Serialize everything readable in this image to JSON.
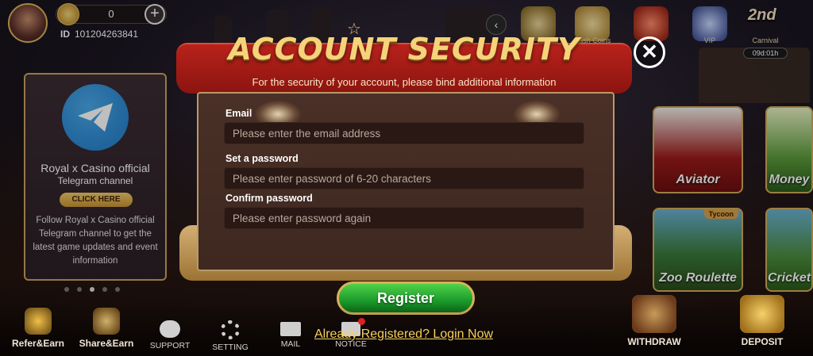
{
  "header": {
    "coin_amount": "0",
    "add_symbol": "+",
    "id_label": "ID",
    "id_value": "101204263841"
  },
  "top_icons": [
    {
      "label": "Cash Coins"
    },
    {
      "label": "VIP"
    },
    {
      "label": "Carnival",
      "badge": "2nd",
      "timer": "09d:01h"
    }
  ],
  "promo": {
    "title": "Royal x Casino official",
    "subtitle": "Telegram channel",
    "cta": "CLICK HERE",
    "description": "Follow Royal x Casino official Telegram channel to get the latest game updates and event information"
  },
  "games": [
    {
      "label": "Aviator"
    },
    {
      "label": "Money"
    },
    {
      "label": "Zoo Roulette",
      "tag": "Tycoon"
    },
    {
      "label": "Cricket"
    }
  ],
  "dialog": {
    "title": "ACCOUNT SECURITY",
    "subtitle": "For the security of your account, please bind additional information",
    "email_label": "Email",
    "email_placeholder": "Please enter the email address",
    "password_label": "Set a password",
    "password_placeholder": "Please enter password of 6-20 characters",
    "confirm_label": "Confirm password",
    "confirm_placeholder": "Please enter password again",
    "register_label": "Register",
    "login_link": "Already Registered? Login Now",
    "close_symbol": "✕"
  },
  "bottom_nav": [
    {
      "label": "Refer&Earn"
    },
    {
      "label": "Share&Earn"
    },
    {
      "label": "SUPPORT"
    },
    {
      "label": "SETTING"
    },
    {
      "label": "MAIL"
    },
    {
      "label": "NOTICE"
    },
    {
      "label": "WITHDRAW"
    },
    {
      "label": "DEPOSIT"
    }
  ],
  "colors": {
    "accent_gold": "#f6d37a",
    "banner_red": "#b8221b",
    "register_green": "#1a9a2a",
    "link_yellow": "#f6d05a"
  }
}
